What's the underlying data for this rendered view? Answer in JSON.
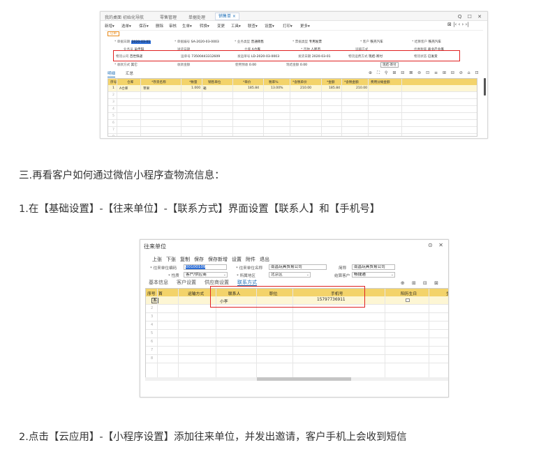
{
  "shot1": {
    "tabs": [
      "我的桌面",
      "初始化导航",
      "零售管理",
      "单据处理",
      "销售单"
    ],
    "window_controls": "Q ☐ ✕",
    "toolbar": [
      "新增▾",
      "选单▾",
      "保存▾",
      "删除",
      "审核",
      "生单▾",
      "转换▾",
      "变更",
      "工具▾",
      "联查▾",
      "设置▾",
      "打印▾",
      "更多▾"
    ],
    "nav_controls": "⊠ |‹ ‹ › ›|",
    "status_tag": "已审",
    "fields_row1": [
      {
        "label": "* 单据日期",
        "value": "2020-03-01"
      },
      {
        "label": "* 单据编号",
        "value": "SA-2020-03-0003"
      },
      {
        "label": "* 业务类型",
        "value": "普通销售"
      },
      {
        "label": "* 票据类型",
        "value": "专用发票"
      },
      {
        "label": "* 客户",
        "value": "铁壳汽车"
      },
      {
        "label": "* 结算客户",
        "value": "铁壳汽车"
      }
    ],
    "fields_row2": [
      {
        "label": "业务员",
        "value": "吴佳琪"
      },
      {
        "label": "送货日期",
        "value": ""
      },
      {
        "label": "仓库",
        "value": "A仓库"
      },
      {
        "label": "* 币种",
        "value": "人民币"
      },
      {
        "label": "运输方式",
        "value": ""
      },
      {
        "label": "优惠税率",
        "value": "商业产业库"
      }
    ],
    "fields_row3": [
      {
        "label": "物流公司",
        "value": "百世快递"
      },
      {
        "label": "运单号",
        "value": "73500443312609"
      },
      {
        "label": "发运单号",
        "value": "LD-2020-03-0003"
      },
      {
        "label": "发货日期",
        "value": "2020-03-01"
      },
      {
        "label": "物流运费方式",
        "value": "现结-寄付"
      },
      {
        "label": "物流状态",
        "value": "已发货"
      }
    ],
    "fields_row4": [
      {
        "label": "* 收款方式",
        "value": "其它"
      },
      {
        "label": "收款金额",
        "value": ""
      },
      {
        "label": "使用预收",
        "value": "0.00"
      },
      {
        "label": "现结金额",
        "value": "0.00"
      }
    ],
    "tooltip": "现结-寄付",
    "subtabs": [
      "明细",
      "汇总"
    ],
    "toolbar_icons": "⊕ ⛶ ⚲ ⊞ ⊟ ⊠ ⊜ ⊡ ≡ ⊞ ⊟ ⊘ ⌂ ⊡",
    "columns": [
      "序号",
      "仓库",
      "*存货名称",
      "*数量",
      "销售单位",
      "*单价",
      "税率%",
      "*含税单价",
      "*金额",
      "*含税金额",
      "费用分摊金额"
    ],
    "rows": [
      [
        "1",
        "A仓库",
        "苹果",
        "1.000",
        "箱",
        "185.84",
        "13.00%",
        "210.00",
        "185.84",
        "210.00",
        ""
      ]
    ],
    "empty_row_numbers": [
      "2",
      "3",
      "4",
      "5",
      "6",
      "7",
      "8"
    ]
  },
  "para1": "三.再看客户如何通过微信小程序查物流信息：",
  "para2": "1.在【基础设置】-【往来单位】-【联系方式】界面设置【联系人】和【手机号】",
  "para3": "2.点击【云应用】-【小程序设置】添加往来单位，并发出邀请，客户手机上会收到短信",
  "shot2": {
    "title": "往来单位",
    "window_controls": "⊙ ✕",
    "toolbar": [
      "上张",
      "下张",
      "复制",
      "保存",
      "保存新增",
      "设置",
      "附件",
      "退出"
    ],
    "code_label": "* 往来单位编码",
    "code_value": "00100109",
    "name_label": "* 往来单位名称",
    "name_value": "南昌玩具贸易公司",
    "short_label": "简称",
    "short_value": "南昌玩具贸易公司",
    "nature_label": "* 性质",
    "nature_value": "客户/供应商",
    "region_label": "* 所属地区",
    "region_value": "北京区",
    "settle_label": "结算客户",
    "settle_value": "畅捷通",
    "subtabs": [
      "基本信息",
      "客户设置",
      "供应商设置",
      "联系方式"
    ],
    "active_subtab": "联系方式",
    "icons": "⊕ ⊞ ⊟ ⊠",
    "columns": [
      "序号",
      "首",
      "运输方式",
      "联系人",
      "职位",
      "手机号",
      "阳历生日",
      "生"
    ],
    "row": {
      "contact": "小李",
      "phone": "15797736911",
      "primary_mark": "五"
    },
    "empty_rows": [
      "2",
      "3",
      "4",
      "5",
      "6",
      "7",
      "8"
    ]
  }
}
